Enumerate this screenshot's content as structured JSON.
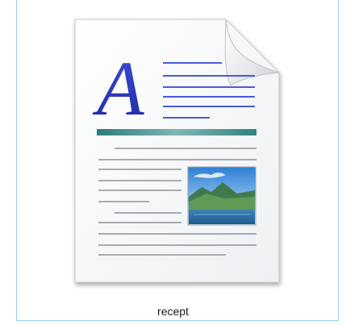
{
  "file_item": {
    "name": "recept",
    "icon": "wordpad-document-icon",
    "selected": true,
    "selection_border_color": "#99d1ff"
  }
}
